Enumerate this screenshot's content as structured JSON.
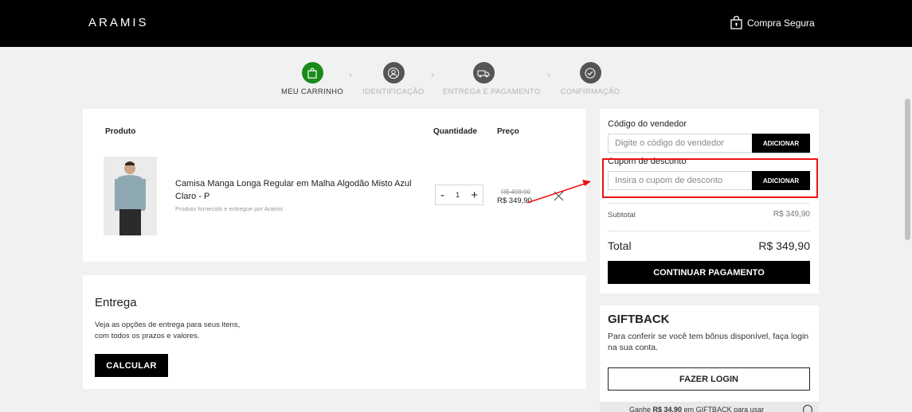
{
  "header": {
    "logo": "ARAMIS",
    "secure_label": "Compra Segura"
  },
  "steps": [
    {
      "label": "MEU CARRINHO",
      "icon": "bag-icon",
      "active": true
    },
    {
      "label": "IDENTIFICAÇÃO",
      "icon": "user-icon",
      "active": false
    },
    {
      "label": "ENTREGA E PAGAMENTO",
      "icon": "truck-icon",
      "active": false
    },
    {
      "label": "CONFIRMAÇÃO",
      "icon": "check-icon",
      "active": false
    }
  ],
  "cart": {
    "headers": {
      "product": "Produto",
      "quantity": "Quantidade",
      "price": "Preço"
    },
    "item": {
      "title": "Camisa Manga Longa Regular em Malha Algodão Misto Azul Claro - P",
      "subtitle": "Produto fornecido e entregue por Aramis",
      "quantity": "1",
      "minus": "-",
      "plus": "+",
      "old_price": "R$ 499,90",
      "price": "R$ 349,90"
    }
  },
  "delivery": {
    "title": "Entrega",
    "text": "Veja as opções de entrega para seus itens, com todos os prazos e valores.",
    "button": "CALCULAR"
  },
  "summary": {
    "seller_label": "Código do vendedor",
    "seller_placeholder": "Digite o código do vendedor",
    "seller_button": "ADICIONAR",
    "coupon_label": "Cupom de desconto",
    "coupon_placeholder": "Insira o cupom de desconto",
    "coupon_button": "ADICIONAR",
    "subtotal_label": "Subtotal",
    "subtotal_value": "R$ 349,90",
    "total_label": "Total",
    "total_value": "R$ 349,90",
    "continue_button": "CONTINUAR PAGAMENTO"
  },
  "giftback": {
    "title": "GIFTBACK",
    "text": "Para conferir se você tem bônus disponível, faça login na sua conta.",
    "login_button": "FAZER LOGIN",
    "note_prefix": "Ganhe ",
    "note_amount": "R$ 34,90",
    "note_suffix": " em GIFTBACK para usar"
  },
  "colors": {
    "header_bg": "#000000",
    "active_step": "#1a8a1a",
    "highlight": "#ee1111"
  }
}
